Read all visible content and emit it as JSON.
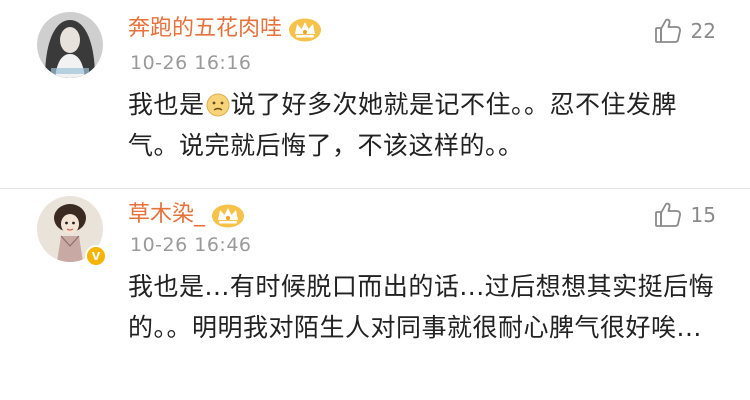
{
  "comments": [
    {
      "username": "奔跑的五花肉哇",
      "timestamp": "10-26 16:16",
      "likes": "22",
      "avatar_icon": "avatar-woman-long-hair",
      "badge_icon": "crown-icon",
      "text_before_emoji": "我也是",
      "emoji_icon": "sad-face-emoji",
      "text_after_emoji": "说了好多次她就是记不住。。忍不住发脾气。说完就后悔了，不该这样的。。"
    },
    {
      "username": "草木染_",
      "timestamp": "10-26 16:46",
      "likes": "15",
      "avatar_icon": "avatar-cartoon-girl",
      "badge_icon": "crown-icon",
      "verified_icon": "v-badge",
      "verified_label": "V",
      "text": "我也是...有时候脱口而出的话...过后想想其实挺后悔的。。明明我对陌生人对同事就很耐心脾气很好唉..."
    }
  ],
  "colors": {
    "username": "#e6713a",
    "timestamp": "#9a9a9a",
    "text": "#222222",
    "crown": "#f0a21b",
    "vip": "#f5b400"
  }
}
